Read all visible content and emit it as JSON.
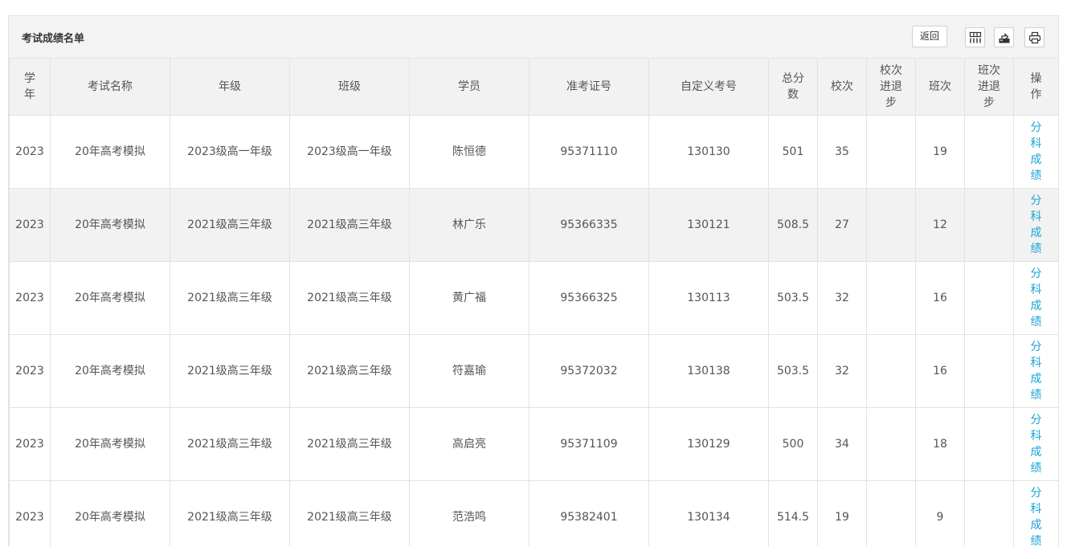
{
  "panel": {
    "title": "考试成绩名单",
    "back_label": "返回",
    "tools": {
      "columns_icon": "columns-grid-icon",
      "export_icon": "export-icon",
      "print_icon": "print-icon"
    }
  },
  "table": {
    "headers": [
      "学年",
      "考试名称",
      "年级",
      "班级",
      "学员",
      "准考证号",
      "自定义考号",
      "总分数",
      "校次",
      "校次进退步",
      "班次",
      "班次进退步",
      "操作"
    ],
    "rows": [
      {
        "year": "2023",
        "exam": "20年高考模拟",
        "grade": "2023级高一年级",
        "class": "2023级高一年级",
        "student": "陈恒德",
        "ticket": "95371110",
        "custom_no": "130130",
        "total": "501",
        "school_rank": "35",
        "school_change": "",
        "class_rank": "19",
        "class_change": "",
        "action": "分科成绩"
      },
      {
        "year": "2023",
        "exam": "20年高考模拟",
        "grade": "2021级高三年级",
        "class": "2021级高三年级",
        "student": "林广乐",
        "ticket": "95366335",
        "custom_no": "130121",
        "total": "508.5",
        "school_rank": "27",
        "school_change": "",
        "class_rank": "12",
        "class_change": "",
        "action": "分科成绩"
      },
      {
        "year": "2023",
        "exam": "20年高考模拟",
        "grade": "2021级高三年级",
        "class": "2021级高三年级",
        "student": "黄广福",
        "ticket": "95366325",
        "custom_no": "130113",
        "total": "503.5",
        "school_rank": "32",
        "school_change": "",
        "class_rank": "16",
        "class_change": "",
        "action": "分科成绩"
      },
      {
        "year": "2023",
        "exam": "20年高考模拟",
        "grade": "2021级高三年级",
        "class": "2021级高三年级",
        "student": "符嘉瑜",
        "ticket": "95372032",
        "custom_no": "130138",
        "total": "503.5",
        "school_rank": "32",
        "school_change": "",
        "class_rank": "16",
        "class_change": "",
        "action": "分科成绩"
      },
      {
        "year": "2023",
        "exam": "20年高考模拟",
        "grade": "2021级高三年级",
        "class": "2021级高三年级",
        "student": "高启亮",
        "ticket": "95371109",
        "custom_no": "130129",
        "total": "500",
        "school_rank": "34",
        "school_change": "",
        "class_rank": "18",
        "class_change": "",
        "action": "分科成绩"
      },
      {
        "year": "2023",
        "exam": "20年高考模拟",
        "grade": "2021级高三年级",
        "class": "2021级高三年级",
        "student": "范浩鸣",
        "ticket": "95382401",
        "custom_no": "130134",
        "total": "514.5",
        "school_rank": "19",
        "school_change": "",
        "class_rank": "9",
        "class_change": "",
        "action": "分科成绩"
      }
    ]
  }
}
